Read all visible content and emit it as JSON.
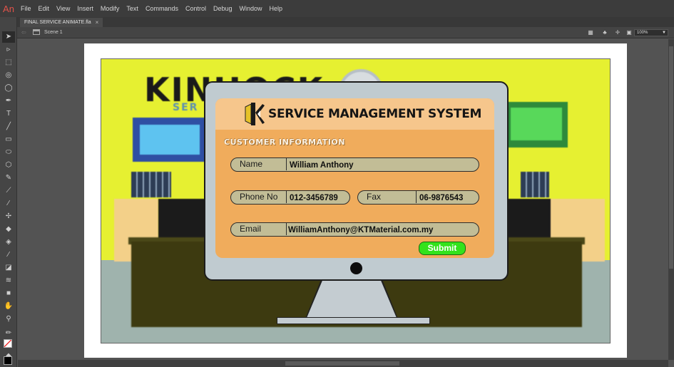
{
  "app": {
    "logo_text": "An"
  },
  "menu": [
    "File",
    "Edit",
    "View",
    "Insert",
    "Modify",
    "Text",
    "Commands",
    "Control",
    "Debug",
    "Window",
    "Help"
  ],
  "document": {
    "tab_title": "FINAL SERVICE ANIMATE.fla",
    "close_glyph": "×"
  },
  "editbar": {
    "scene_label": "Scene 1",
    "zoom_value": "100%"
  },
  "tools": [
    "selection-tool",
    "subselection-tool",
    "free-transform-tool",
    "3d-rotation-tool",
    "lasso-tool",
    "pen-tool",
    "text-tool",
    "line-tool",
    "rectangle-tool",
    "oval-tool",
    "polystar-tool",
    "pencil-tool",
    "brush-tool",
    "paint-brush-tool",
    "bone-tool",
    "paint-bucket-tool",
    "ink-bottle-tool",
    "eyedropper-tool",
    "eraser-tool",
    "width-tool",
    "camera-tool",
    "hand-tool",
    "zoom-tool"
  ],
  "stage": {
    "background_logo": {
      "text": "KINHOCK",
      "sub": "SER"
    },
    "form": {
      "system_title": "SERVICE MANAGEMENT SYSTEM",
      "section_title": "CUSTOMER INFORMATION",
      "name_label": "Name",
      "name_value": "William Anthony",
      "phone_label": "Phone No",
      "phone_value": "012-3456789",
      "fax_label": "Fax",
      "fax_value": "06-9876543",
      "email_label": "Email",
      "email_value": "WilliamAnthony@KTMaterial.com.my",
      "submit_label": "Submit"
    }
  },
  "colors": {
    "wall": "#e6f031",
    "screen": "#f0ac5c",
    "screen_header": "#f6c68c",
    "field": "#c2bd96",
    "submit": "#33e21c",
    "monitor": "#c0cbd0"
  }
}
